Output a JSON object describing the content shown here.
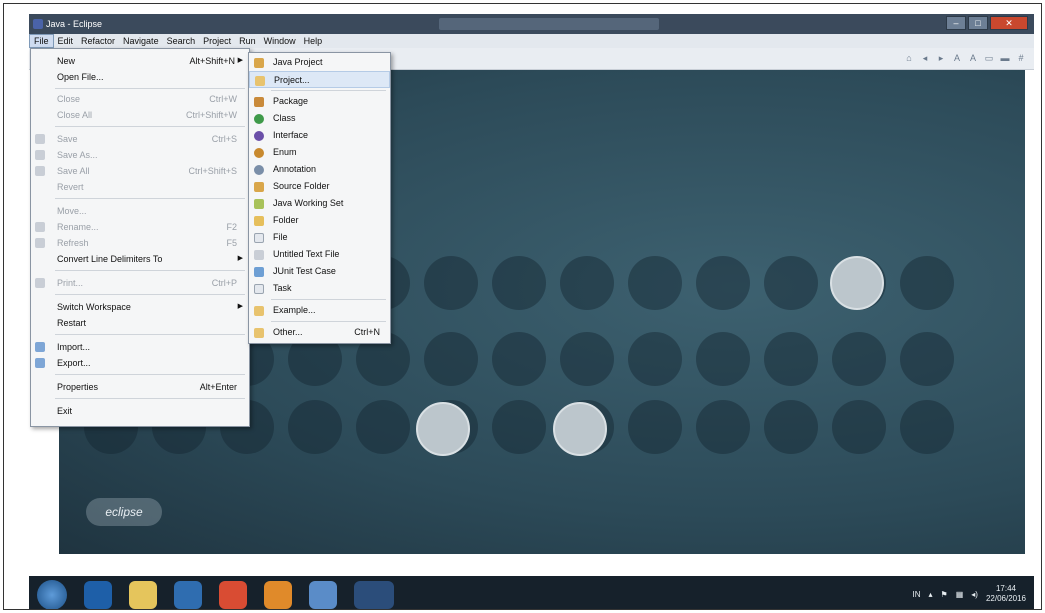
{
  "window": {
    "title": "Java - Eclipse"
  },
  "menubar": [
    "File",
    "Edit",
    "Refactor",
    "Navigate",
    "Search",
    "Project",
    "Run",
    "Window",
    "Help"
  ],
  "file_menu": {
    "new": {
      "label": "New",
      "shortcut": "Alt+Shift+N"
    },
    "open_file": {
      "label": "Open File..."
    },
    "close": {
      "label": "Close",
      "shortcut": "Ctrl+W"
    },
    "close_all": {
      "label": "Close All",
      "shortcut": "Ctrl+Shift+W"
    },
    "save": {
      "label": "Save",
      "shortcut": "Ctrl+S"
    },
    "save_as": {
      "label": "Save As..."
    },
    "save_all": {
      "label": "Save All",
      "shortcut": "Ctrl+Shift+S"
    },
    "revert": {
      "label": "Revert"
    },
    "move": {
      "label": "Move..."
    },
    "rename": {
      "label": "Rename...",
      "shortcut": "F2"
    },
    "refresh": {
      "label": "Refresh",
      "shortcut": "F5"
    },
    "convert": {
      "label": "Convert Line Delimiters To"
    },
    "print": {
      "label": "Print...",
      "shortcut": "Ctrl+P"
    },
    "switch_ws": {
      "label": "Switch Workspace"
    },
    "restart": {
      "label": "Restart"
    },
    "import": {
      "label": "Import..."
    },
    "export": {
      "label": "Export..."
    },
    "properties": {
      "label": "Properties",
      "shortcut": "Alt+Enter"
    },
    "exit": {
      "label": "Exit"
    }
  },
  "new_submenu": {
    "java_project": {
      "label": "Java Project"
    },
    "project": {
      "label": "Project..."
    },
    "package": {
      "label": "Package"
    },
    "class": {
      "label": "Class"
    },
    "interface": {
      "label": "Interface"
    },
    "enum": {
      "label": "Enum"
    },
    "annotation": {
      "label": "Annotation"
    },
    "source_folder": {
      "label": "Source Folder"
    },
    "working_set": {
      "label": "Java Working Set"
    },
    "folder": {
      "label": "Folder"
    },
    "file": {
      "label": "File"
    },
    "untitled": {
      "label": "Untitled Text File"
    },
    "junit": {
      "label": "JUnit Test Case"
    },
    "task": {
      "label": "Task"
    },
    "example": {
      "label": "Example..."
    },
    "other": {
      "label": "Other...",
      "shortcut": "Ctrl+N"
    }
  },
  "welcome": {
    "logo_text": "eclipse"
  },
  "taskbar": {
    "lang": "IN",
    "time": "17:44",
    "date": "22/06/2016"
  }
}
